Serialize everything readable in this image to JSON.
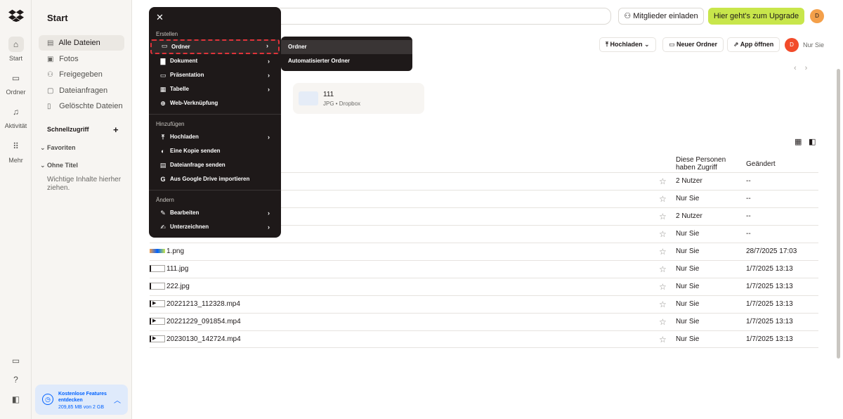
{
  "rail": {
    "items": [
      {
        "label": "Start",
        "icon": "home-icon",
        "glyph": "⌂"
      },
      {
        "label": "Ordner",
        "icon": "folder-icon",
        "glyph": "▭"
      },
      {
        "label": "Aktivität",
        "icon": "bell-icon",
        "glyph": "♫"
      },
      {
        "label": "Mehr",
        "icon": "grid-icon",
        "glyph": "⠿"
      }
    ],
    "bottom": [
      {
        "icon": "desktop-icon",
        "glyph": "▭"
      },
      {
        "icon": "help-icon",
        "glyph": "?"
      },
      {
        "icon": "panel-icon",
        "glyph": "◧"
      }
    ]
  },
  "sidebar": {
    "title": "Start",
    "items": [
      {
        "label": "Alle Dateien",
        "icon": "files-icon",
        "glyph": "▤"
      },
      {
        "label": "Fotos",
        "icon": "photo-icon",
        "glyph": "▣"
      },
      {
        "label": "Freigegeben",
        "icon": "shared-icon",
        "glyph": "⚇"
      },
      {
        "label": "Dateianfragen",
        "icon": "file-request-icon",
        "glyph": "▢"
      },
      {
        "label": "Gelöschte Dateien",
        "icon": "trash-icon",
        "glyph": "▯"
      }
    ],
    "quick_access": "Schnellzugriff",
    "favorites": "Favoriten",
    "untitled": "Ohne Titel",
    "hint": "Wichtige Inhalte hierher ziehen.",
    "promo": {
      "title": "Kostenlose Features entdecken",
      "storage": "209,85 MB von 2 GB"
    }
  },
  "topbar": {
    "invite": "Mitglieder einladen",
    "upgrade": "Hier geht's zum Upgrade",
    "avatar": "D"
  },
  "toolbar": {
    "upload": "Hochladen",
    "new_folder": "Neuer Ordner",
    "open_app": "App öffnen",
    "avatar": "D",
    "only_you": "Nur Sie"
  },
  "suggested": {
    "name": "111",
    "meta": "JPG • Dropbox"
  },
  "table": {
    "headers": {
      "access": "Diese Personen haben Zugriff",
      "modified": "Geändert"
    },
    "rows": [
      {
        "name": "",
        "type": "folder",
        "access": "2 Nutzer",
        "modified": "--"
      },
      {
        "name": "",
        "type": "folder",
        "access": "Nur Sie",
        "modified": "--"
      },
      {
        "name": "",
        "type": "folder",
        "access": "2 Nutzer",
        "modified": "--"
      },
      {
        "name": "",
        "type": "folder",
        "access": "Nur Sie",
        "modified": "--"
      },
      {
        "name": "1.png",
        "type": "png",
        "access": "Nur Sie",
        "modified": "28/7/2025 17:03"
      },
      {
        "name": "111.jpg",
        "type": "jpg",
        "access": "Nur Sie",
        "modified": "1/7/2025 13:13"
      },
      {
        "name": "222.jpg",
        "type": "jpg",
        "access": "Nur Sie",
        "modified": "1/7/2025 13:13"
      },
      {
        "name": "20221213_112328.mp4",
        "type": "mp4",
        "access": "Nur Sie",
        "modified": "1/7/2025 13:13"
      },
      {
        "name": "20221229_091854.mp4",
        "type": "mp4",
        "access": "Nur Sie",
        "modified": "1/7/2025 13:13"
      },
      {
        "name": "20230130_142724.mp4",
        "type": "mp4",
        "access": "Nur Sie",
        "modified": "1/7/2025 13:13"
      }
    ]
  },
  "menu": {
    "sections": {
      "create": "Erstellen",
      "add": "Hinzufügen",
      "change": "Ändern"
    },
    "create_items": [
      {
        "label": "Ordner",
        "icon": "folder-icon",
        "glyph": "▭",
        "submenu": true
      },
      {
        "label": "Dokument",
        "icon": "document-icon",
        "glyph": "▇",
        "submenu": true
      },
      {
        "label": "Präsentation",
        "icon": "presentation-icon",
        "glyph": "▭",
        "submenu": true
      },
      {
        "label": "Tabelle",
        "icon": "table-icon",
        "glyph": "▦",
        "submenu": true
      },
      {
        "label": "Web-Verknüpfung",
        "icon": "globe-icon",
        "glyph": "⊕",
        "submenu": false
      }
    ],
    "add_items": [
      {
        "label": "Hochladen",
        "icon": "upload-icon",
        "glyph": "⤒",
        "submenu": true
      },
      {
        "label": "Eine Kopie senden",
        "icon": "send-copy-icon",
        "glyph": "◐",
        "submenu": false
      },
      {
        "label": "Dateianfrage senden",
        "icon": "file-request-icon",
        "glyph": "▤",
        "submenu": false
      },
      {
        "label": "Aus Google Drive importieren",
        "icon": "google-icon",
        "glyph": "G",
        "submenu": false
      }
    ],
    "change_items": [
      {
        "label": "Bearbeiten",
        "icon": "edit-icon",
        "glyph": "✎",
        "submenu": true
      },
      {
        "label": "Unterzeichnen",
        "icon": "sign-icon",
        "glyph": "✍",
        "submenu": true
      }
    ],
    "submenu_items": [
      "Ordner",
      "Automatisierter Ordner"
    ]
  }
}
